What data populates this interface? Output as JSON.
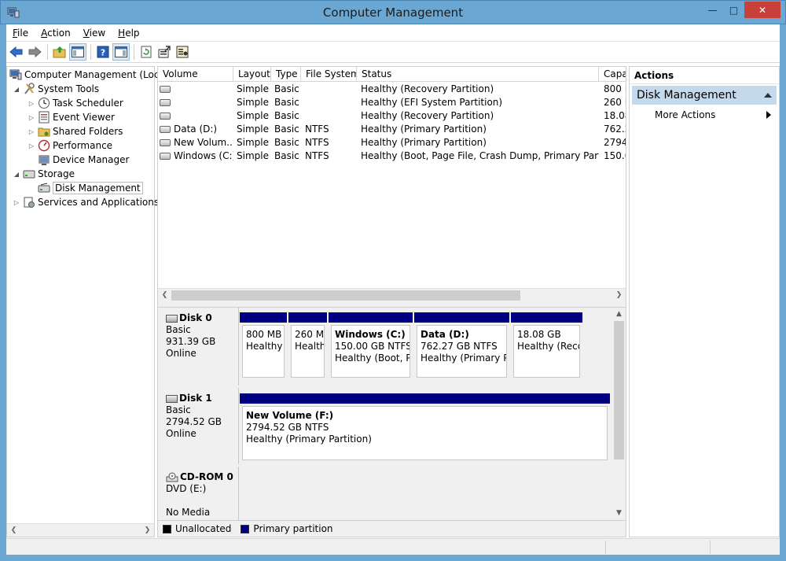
{
  "window": {
    "title": "Computer Management",
    "controls": {
      "minimize": "—",
      "maximize": "□",
      "close": "✕"
    }
  },
  "menu": [
    {
      "label": "File",
      "accel": "F",
      "rest": "ile"
    },
    {
      "label": "Action",
      "accel": "A",
      "rest": "ction"
    },
    {
      "label": "View",
      "accel": "V",
      "rest": "iew"
    },
    {
      "label": "Help",
      "accel": "H",
      "rest": "elp"
    }
  ],
  "toolbar": {
    "icons": [
      "back-arrow-icon",
      "forward-arrow-icon",
      "up-folder-icon",
      "show-hide-tree-icon",
      "help-icon",
      "show-hide-action-pane-icon",
      "refresh-icon",
      "export-icon",
      "properties-icon"
    ]
  },
  "tree": {
    "items": [
      {
        "label": "Computer Management (Local",
        "icon": "computer-icon",
        "expander": ""
      },
      {
        "label": "System Tools",
        "icon": "tools-icon",
        "expander": "◢"
      },
      {
        "label": "Task Scheduler",
        "icon": "clock-icon",
        "expander": "▷"
      },
      {
        "label": "Event Viewer",
        "icon": "event-viewer-icon",
        "expander": "▷"
      },
      {
        "label": "Shared Folders",
        "icon": "shared-folder-icon",
        "expander": "▷"
      },
      {
        "label": "Performance",
        "icon": "performance-icon",
        "expander": "▷"
      },
      {
        "label": "Device Manager",
        "icon": "device-manager-icon",
        "expander": ""
      },
      {
        "label": "Storage",
        "icon": "storage-icon",
        "expander": "◢"
      },
      {
        "label": "Disk Management",
        "icon": "disk-management-icon",
        "expander": ""
      },
      {
        "label": "Services and Applications",
        "icon": "services-icon",
        "expander": "▷"
      }
    ]
  },
  "volume_list": {
    "columns": [
      "Volume",
      "Layout",
      "Type",
      "File System",
      "Status",
      "Capa"
    ],
    "rows": [
      {
        "volume": "",
        "layout": "Simple",
        "type": "Basic",
        "fs": "",
        "status": "Healthy (Recovery Partition)",
        "capacity": "800 M"
      },
      {
        "volume": "",
        "layout": "Simple",
        "type": "Basic",
        "fs": "",
        "status": "Healthy (EFI System Partition)",
        "capacity": "260 M"
      },
      {
        "volume": "",
        "layout": "Simple",
        "type": "Basic",
        "fs": "",
        "status": "Healthy (Recovery Partition)",
        "capacity": "18.08"
      },
      {
        "volume": "Data (D:)",
        "layout": "Simple",
        "type": "Basic",
        "fs": "NTFS",
        "status": "Healthy (Primary Partition)",
        "capacity": "762.2"
      },
      {
        "volume": "New Volum...",
        "layout": "Simple",
        "type": "Basic",
        "fs": "NTFS",
        "status": "Healthy (Primary Partition)",
        "capacity": "2794."
      },
      {
        "volume": "Windows (C:)",
        "layout": "Simple",
        "type": "Basic",
        "fs": "NTFS",
        "status": "Healthy (Boot, Page File, Crash Dump, Primary Partition)",
        "capacity": "150.0"
      }
    ]
  },
  "disks": [
    {
      "name": "Disk 0",
      "kind": "Basic",
      "size": "931.39 GB",
      "state": "Online",
      "partitions": [
        {
          "name": "",
          "size": "800 MB",
          "status": "Healthy"
        },
        {
          "name": "",
          "size": "260 MI",
          "status": "Health"
        },
        {
          "name": "Windows  (C:)",
          "size": "150.00 GB NTFS",
          "status": "Healthy (Boot, Pa"
        },
        {
          "name": "Data  (D:)",
          "size": "762.27 GB NTFS",
          "status": "Healthy (Primary Par"
        },
        {
          "name": "",
          "size": "18.08 GB",
          "status": "Healthy (Recov"
        }
      ]
    },
    {
      "name": "Disk 1",
      "kind": "Basic",
      "size": "2794.52 GB",
      "state": "Online",
      "partitions": [
        {
          "name": "New Volume  (F:)",
          "size": "2794.52 GB NTFS",
          "status": "Healthy (Primary Partition)"
        }
      ]
    },
    {
      "name": "CD-ROM 0",
      "kind": "DVD (E:)",
      "size": "",
      "state": "No Media",
      "partitions": []
    }
  ],
  "legend": [
    {
      "label": "Unallocated",
      "color": "#000000"
    },
    {
      "label": "Primary partition",
      "color": "#000080"
    }
  ],
  "actions": {
    "header": "Actions",
    "section": "Disk Management",
    "more": "More Actions"
  },
  "colors": {
    "titlebar": "#6ba7d3",
    "partition_bar": "#000080",
    "action_section": "#c5d9ec",
    "close_button": "#c7403a"
  }
}
